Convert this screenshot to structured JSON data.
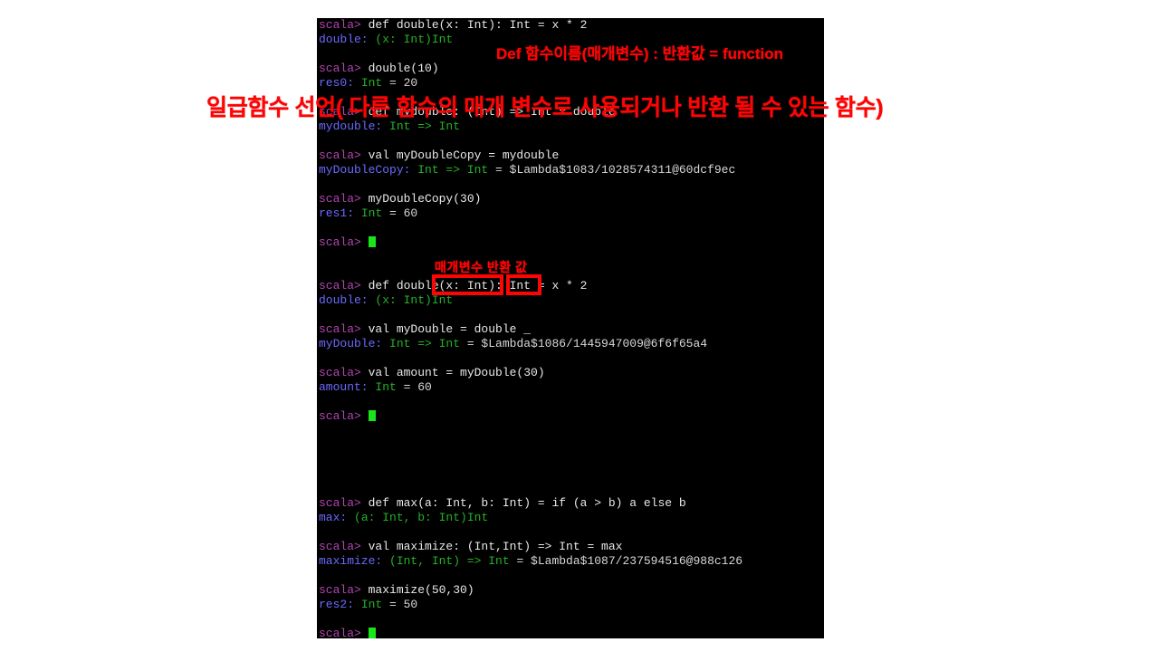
{
  "terminal": {
    "prompt": "scala> ",
    "cursor_glyph": "block-cursor",
    "colors": {
      "background": "#000000",
      "prompt": "#b246b2",
      "input": "#e8e8e8",
      "name": "#6a6aff",
      "type": "#26b226",
      "cursor": "#19e619",
      "annotation": "#fb0505"
    },
    "lines": [
      {
        "type": "cmd",
        "prompt": "scala> ",
        "input": "def double(x: Int): Int = x * 2"
      },
      {
        "type": "out",
        "name": "double",
        "sep": ": ",
        "typ": "(x: Int)Int",
        "val": ""
      },
      {
        "type": "blank"
      },
      {
        "type": "cmd",
        "prompt": "scala> ",
        "input": "double(10)"
      },
      {
        "type": "out",
        "name": "res0",
        "sep": ": ",
        "typ": "Int",
        "val": " = 20"
      },
      {
        "type": "blank"
      },
      {
        "type": "cmd",
        "prompt": "scala> ",
        "input": "def mydouble: (Int) => Int = double"
      },
      {
        "type": "out",
        "name": "mydouble",
        "sep": ": ",
        "typ": "Int => Int",
        "val": ""
      },
      {
        "type": "blank"
      },
      {
        "type": "cmd",
        "prompt": "scala> ",
        "input": "val myDoubleCopy = mydouble"
      },
      {
        "type": "out",
        "name": "myDoubleCopy",
        "sep": ": ",
        "typ": "Int => Int",
        "val": " = $Lambda$1083/1028574311@60dcf9ec"
      },
      {
        "type": "blank"
      },
      {
        "type": "cmd",
        "prompt": "scala> ",
        "input": "myDoubleCopy(30)"
      },
      {
        "type": "out",
        "name": "res1",
        "sep": ": ",
        "typ": "Int",
        "val": " = 60"
      },
      {
        "type": "blank"
      },
      {
        "type": "cursor",
        "prompt": "scala> "
      },
      {
        "type": "blank"
      },
      {
        "type": "blank"
      },
      {
        "type": "cmd",
        "prompt": "scala> ",
        "input": "def double(x: Int): Int = x * 2"
      },
      {
        "type": "out",
        "name": "double",
        "sep": ": ",
        "typ": "(x: Int)Int",
        "val": ""
      },
      {
        "type": "blank"
      },
      {
        "type": "cmd",
        "prompt": "scala> ",
        "input": "val myDouble = double _"
      },
      {
        "type": "out",
        "name": "myDouble",
        "sep": ": ",
        "typ": "Int => Int",
        "val": " = $Lambda$1086/1445947009@6f6f65a4"
      },
      {
        "type": "blank"
      },
      {
        "type": "cmd",
        "prompt": "scala> ",
        "input": "val amount = myDouble(30)"
      },
      {
        "type": "out",
        "name": "amount",
        "sep": ": ",
        "typ": "Int",
        "val": " = 60"
      },
      {
        "type": "blank"
      },
      {
        "type": "cursor",
        "prompt": "scala> "
      },
      {
        "type": "blank"
      },
      {
        "type": "blank"
      },
      {
        "type": "blank"
      },
      {
        "type": "blank"
      },
      {
        "type": "blank"
      },
      {
        "type": "cmd",
        "prompt": "scala> ",
        "input": "def max(a: Int, b: Int) = if (a > b) a else b"
      },
      {
        "type": "out",
        "name": "max",
        "sep": ": ",
        "typ": "(a: Int, b: Int)Int",
        "val": ""
      },
      {
        "type": "blank"
      },
      {
        "type": "cmd",
        "prompt": "scala> ",
        "input": "val maximize: (Int,Int) => Int = max"
      },
      {
        "type": "out",
        "name": "maximize",
        "sep": ": ",
        "typ": "(Int, Int) => Int",
        "val": " = $Lambda$1087/237594516@988c126"
      },
      {
        "type": "blank"
      },
      {
        "type": "cmd",
        "prompt": "scala> ",
        "input": "maximize(50,30)"
      },
      {
        "type": "out",
        "name": "res2",
        "sep": ": ",
        "typ": "Int",
        "val": " = 50"
      },
      {
        "type": "blank"
      },
      {
        "type": "cursor",
        "prompt": "scala> "
      }
    ]
  },
  "annotations": {
    "def_signature": "Def 함수이름(매개변수) : 반환값 = function",
    "first_class": "일급함수 선언( 다른 함수의 매개 변수로 사용되거나 반환 될 수 있는 함수)",
    "param_return": "매개변수 반환 값",
    "highlight_param": "(x: Int)",
    "highlight_return": "Int"
  }
}
